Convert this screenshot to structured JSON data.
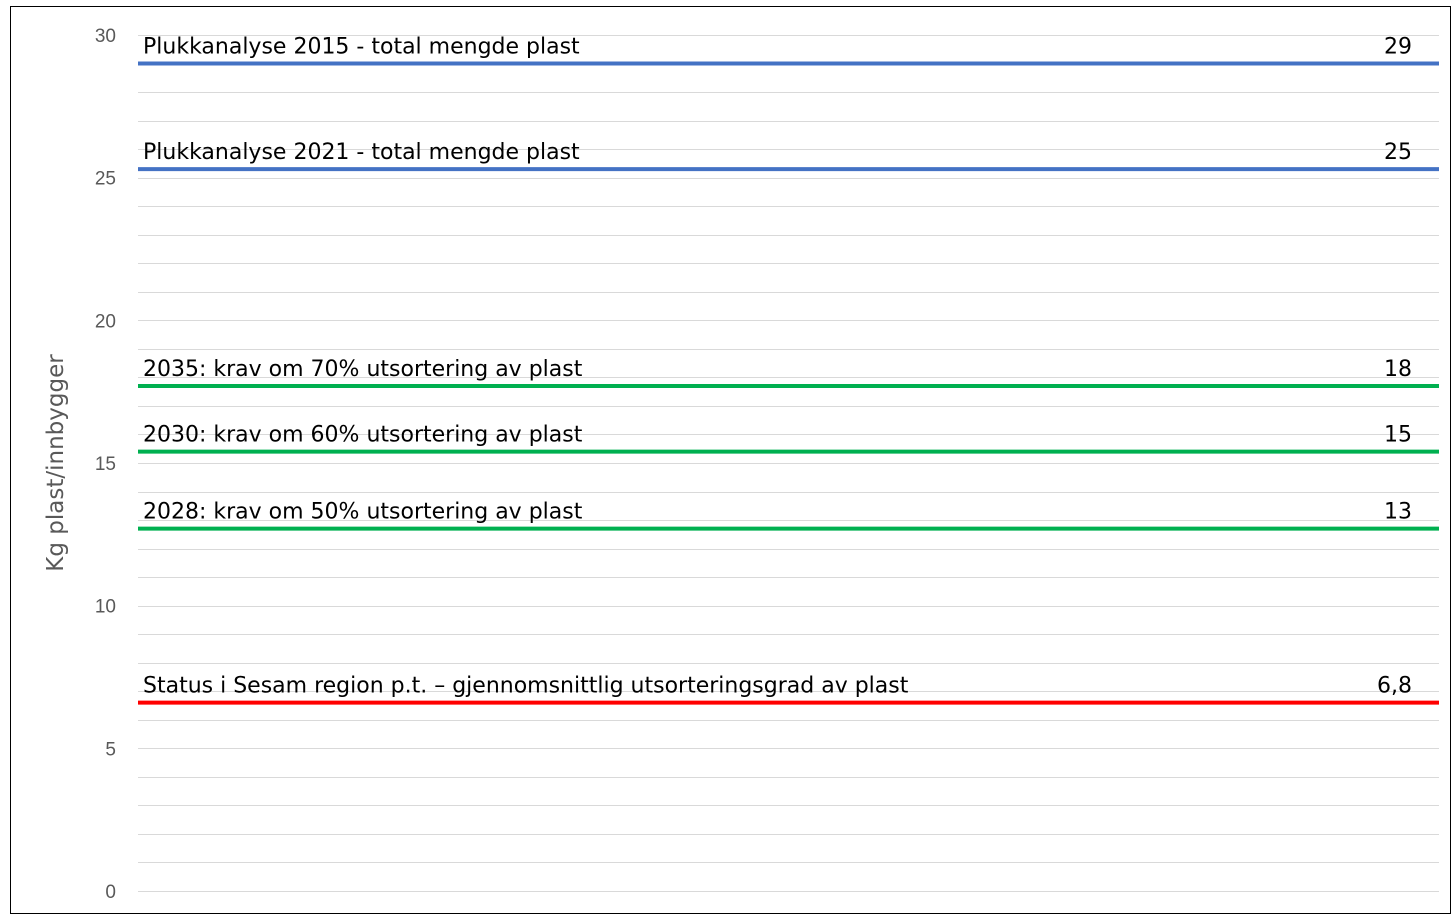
{
  "chart_data": {
    "type": "line",
    "title": "",
    "xlabel": "",
    "ylabel": "Kg plast/innbygger",
    "ylim": [
      0,
      30
    ],
    "yticks": [
      0,
      5,
      10,
      15,
      20,
      25,
      30
    ],
    "grid": true,
    "minor_gridlines_per_tick": 5,
    "reference_lines": [
      {
        "label": "Plukkanalyse 2015 - total mengde plast",
        "value": 29,
        "display": "29",
        "color": "#4472c4"
      },
      {
        "label": "Plukkanalyse 2021 - total mengde plast",
        "value": 25.3,
        "display": "25",
        "color": "#4472c4"
      },
      {
        "label": "2035: krav om 70% utsortering av plast",
        "value": 17.7,
        "display": "18",
        "color": "#00b050"
      },
      {
        "label": "2030: krav om 60% utsortering av plast",
        "value": 15.4,
        "display": "15",
        "color": "#00b050"
      },
      {
        "label": "2028: krav om 50% utsortering av plast",
        "value": 12.7,
        "display": "13",
        "color": "#00b050"
      },
      {
        "label": "Status i Sesam region p.t. – gjennomsnittlig utsorteringsgrad av plast",
        "value": 6.6,
        "display": "6,8",
        "color": "#ff0000"
      }
    ]
  }
}
